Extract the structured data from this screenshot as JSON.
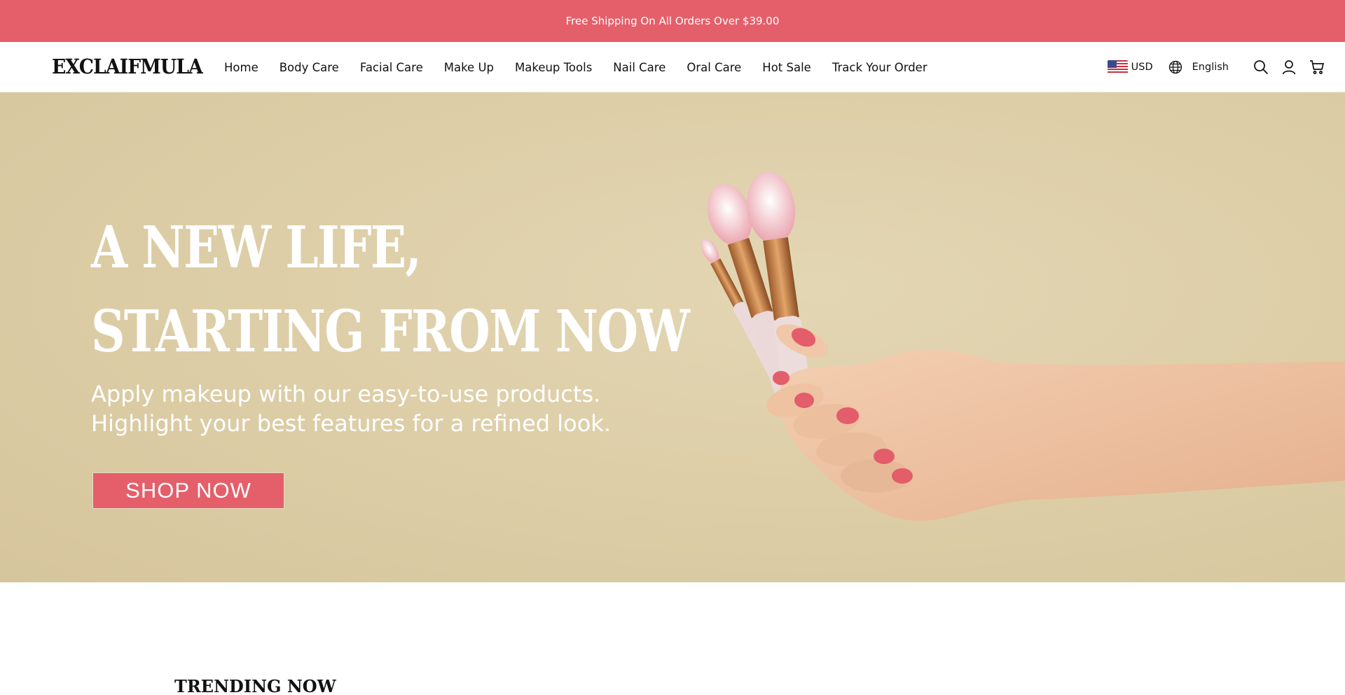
{
  "announcement": {
    "text": "Free Shipping On All Orders Over $39.00"
  },
  "brand": {
    "logo": "EXCLAIFMULA"
  },
  "nav": {
    "items": [
      {
        "label": "Home"
      },
      {
        "label": "Body Care"
      },
      {
        "label": "Facial Care"
      },
      {
        "label": "Make Up"
      },
      {
        "label": "Makeup Tools"
      },
      {
        "label": "Nail Care"
      },
      {
        "label": "Oral Care"
      },
      {
        "label": "Hot Sale"
      },
      {
        "label": "Track Your Order"
      }
    ]
  },
  "utility": {
    "currency": "USD",
    "language": "English",
    "icons": [
      "us-flag-icon",
      "globe-icon",
      "search-icon",
      "account-icon",
      "cart-icon"
    ]
  },
  "hero": {
    "title_line1": "A NEW LIFE,",
    "title_line2": "STARTING FROM NOW",
    "subtitle_line1": "Apply makeup with our easy-to-use products.",
    "subtitle_line2": "Highlight your best features for a refined look.",
    "cta": "SHOP NOW"
  },
  "sections": {
    "trending_title": "TRENDING NOW"
  },
  "colors": {
    "accent": "#e45f6a",
    "hero_background": "#dccda6",
    "text": "#111111",
    "skin": "#efc6a6",
    "nail": "#e35d6a",
    "brush_handle": "#ebdada",
    "ferrule": "#c98a4a"
  }
}
